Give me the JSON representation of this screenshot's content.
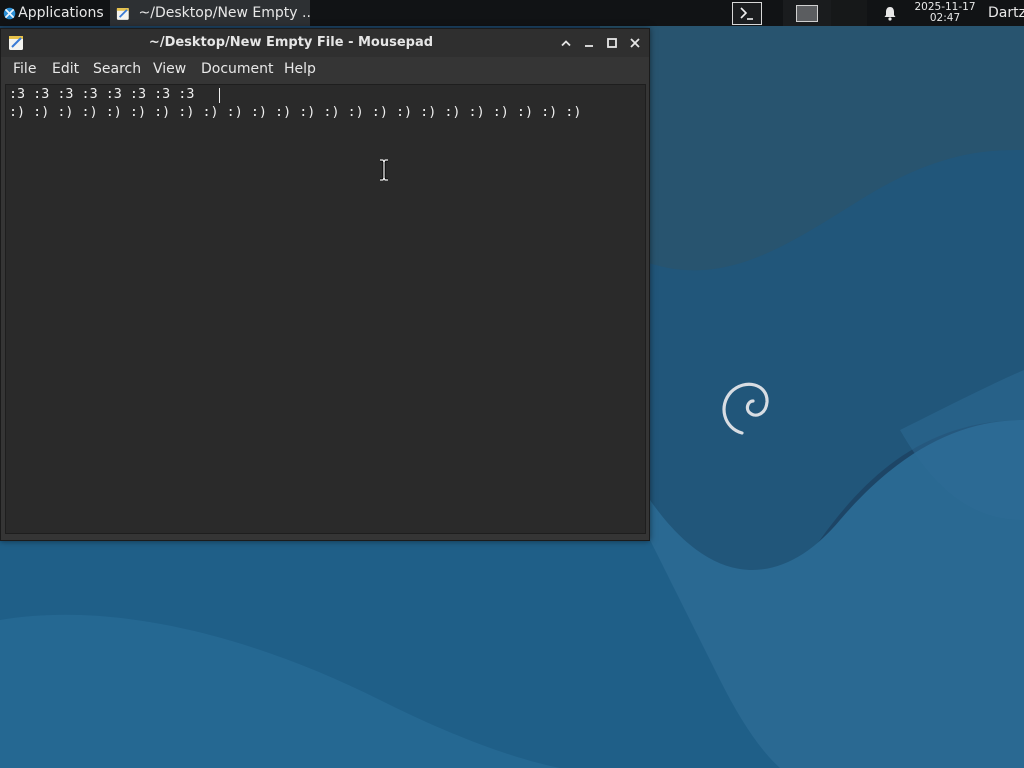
{
  "panel": {
    "applications_label": "Applications ☰",
    "taskbar_title": "~/Desktop/New Empty ...",
    "clock_date": "2025-11-17",
    "clock_time": "02:47",
    "user_label": "Dartz"
  },
  "window": {
    "title": "~/Desktop/New Empty File - Mousepad",
    "menus": [
      "File",
      "Edit",
      "Search",
      "View",
      "Document",
      "Help"
    ]
  },
  "editor": {
    "lines": [
      ":3 :3 :3 :3 :3 :3 :3 :3",
      ":) :) :) :) :) :) :) :) :) :) :) :) :) :) :) :) :) :) :) :) :) :) :) :)"
    ]
  },
  "colors": {
    "panel_bg": "#111315",
    "window_bg": "#353535",
    "editor_bg": "#2a2a2a",
    "desktop_bg": "#1f4a6e"
  },
  "icons": {
    "apps": "xfce-icon",
    "taskbar": "mousepad-icon",
    "terminal": "terminal-icon",
    "notifications": "bell-icon",
    "window_controls": [
      "shade-icon",
      "minimize-icon",
      "maximize-icon",
      "close-icon"
    ]
  }
}
